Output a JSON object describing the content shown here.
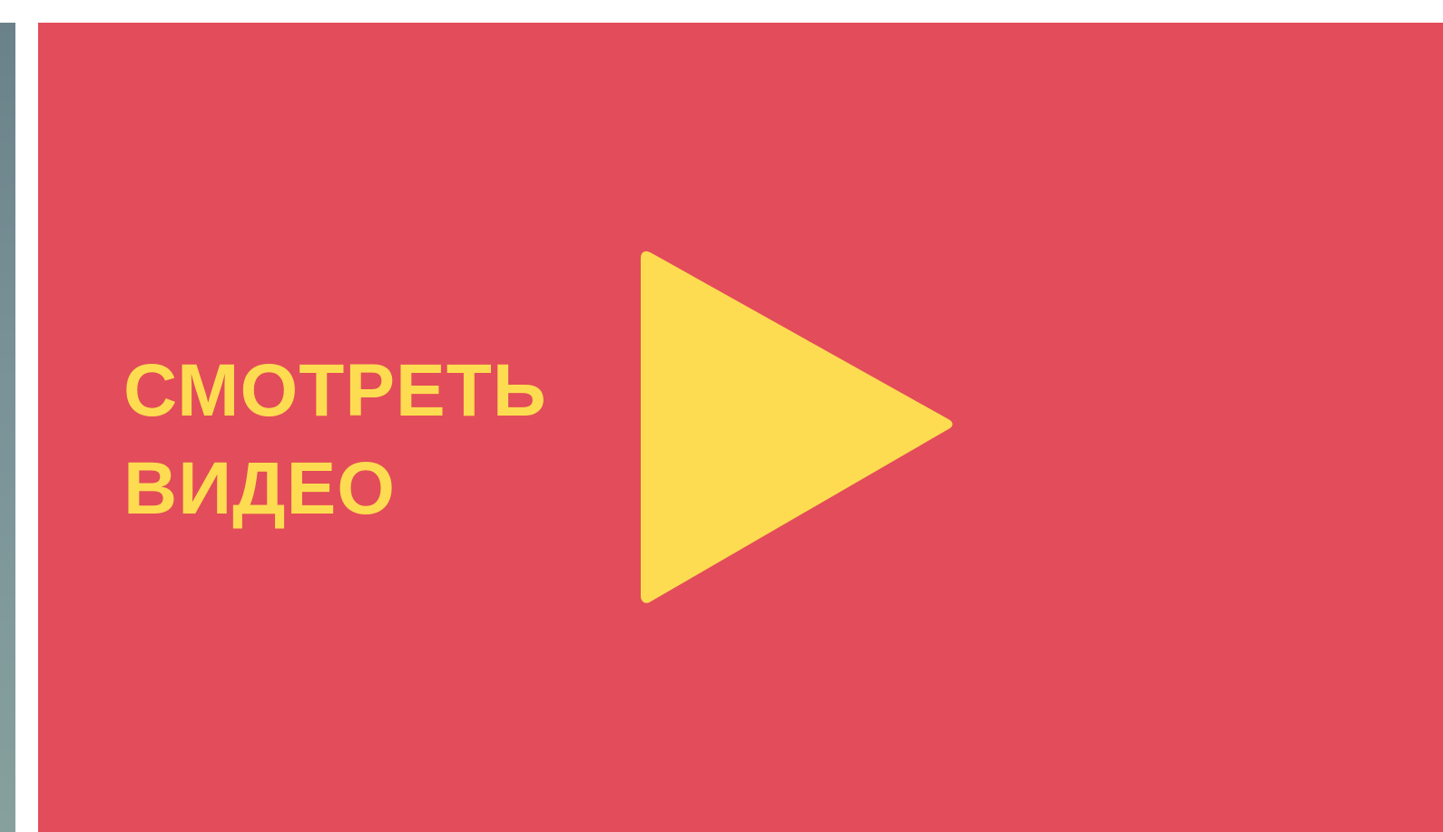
{
  "video_cta": {
    "line_1": "СМОТРЕТЬ",
    "line_2": "ВИДЕО",
    "play_icon": "play-icon"
  },
  "colors": {
    "panel_background": "#e34c5a",
    "accent_yellow": "#fedc51",
    "side_strip": "#7a9298"
  }
}
